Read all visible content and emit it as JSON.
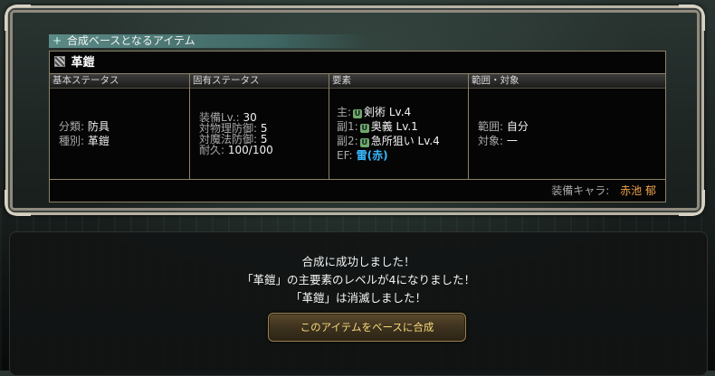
{
  "panel": {
    "title": "合成ベースとなるアイテム",
    "item_name": "革鎧",
    "columns": {
      "basic": {
        "header": "基本ステータス",
        "rows": [
          {
            "label": "分類:",
            "value": "防具"
          },
          {
            "label": "種別:",
            "value": "革鎧"
          }
        ]
      },
      "unique": {
        "header": "固有ステータス",
        "rows": [
          {
            "label": "装備Lv.:",
            "value": "30"
          },
          {
            "label": "対物理防御:",
            "value": "5"
          },
          {
            "label": "対魔法防御:",
            "value": "5"
          },
          {
            "label": "耐久:",
            "value": "100/100"
          }
        ]
      },
      "elements": {
        "header": "要素",
        "rows": [
          {
            "label": "主:",
            "badge": "U",
            "value": "剣術 Lv.4"
          },
          {
            "label": "副1:",
            "badge": "U",
            "value": "奥義 Lv.1"
          },
          {
            "label": "副2:",
            "badge": "U",
            "value": "急所狙い Lv.4"
          }
        ],
        "ef_label": "EF:",
        "ef_value": "雷(赤)",
        "ef_color": "#39b8ff"
      },
      "range": {
        "header": "範囲・対象",
        "rows": [
          {
            "label": "範囲:",
            "value": "自分"
          },
          {
            "label": "対象:",
            "value": "一"
          }
        ]
      }
    },
    "equip_chara_label": "装備キャラ:",
    "equip_chara_name": "赤池 郁",
    "equip_chara_color": "#f0a34a"
  },
  "dialog": {
    "messages": [
      "合成に成功しました！",
      "「革鎧」の主要素のレベルが4になりました！",
      "「革鎧」は消滅しました！"
    ],
    "button_label": "このアイテムをベースに合成"
  }
}
